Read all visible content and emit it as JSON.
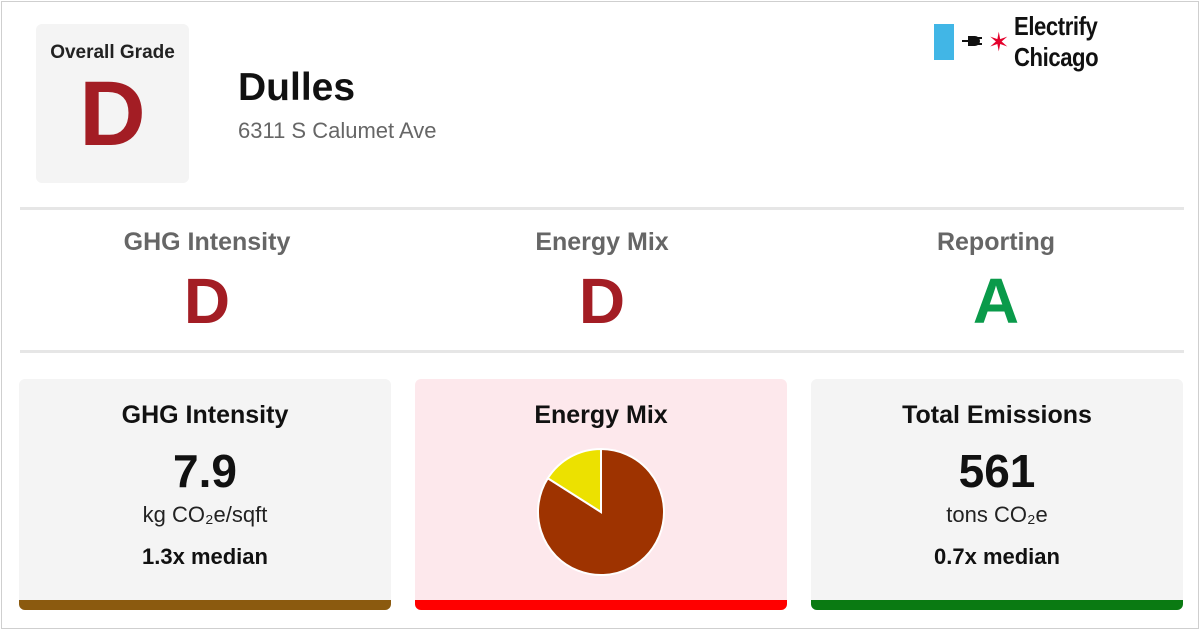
{
  "overall": {
    "label": "Overall Grade",
    "grade": "D",
    "color": "#a31d24"
  },
  "building": {
    "name": "Dulles",
    "address": "6311 S Calumet Ave"
  },
  "logo": {
    "text": "Electrify Chicago",
    "flag_color": "#41b6e6",
    "star_color": "#e4002b",
    "icons": [
      "plug-icon",
      "chicago-star-icon"
    ]
  },
  "subgrades": [
    {
      "title": "GHG Intensity",
      "grade": "D",
      "color": "#a31d24"
    },
    {
      "title": "Energy Mix",
      "grade": "D",
      "color": "#a31d24"
    },
    {
      "title": "Reporting",
      "grade": "A",
      "color": "#0a9a4a"
    }
  ],
  "cards": {
    "ghg": {
      "title": "GHG Intensity",
      "value": "7.9",
      "unit": "kg CO₂e/sqft",
      "median": "1.3x median",
      "bar_color": "#8b5a0f"
    },
    "mix": {
      "title": "Energy Mix",
      "bar_color": "#ff0000",
      "background": "#fde8ec"
    },
    "emissions": {
      "title": "Total Emissions",
      "value": "561",
      "unit": "tons CO₂e",
      "median": "0.7x median",
      "bar_color": "#0a7a12"
    }
  },
  "chart_data": {
    "type": "pie",
    "title": "",
    "series": [
      {
        "value": 84,
        "color": "#9e3300"
      },
      {
        "value": 16,
        "color": "#ece100"
      }
    ]
  }
}
